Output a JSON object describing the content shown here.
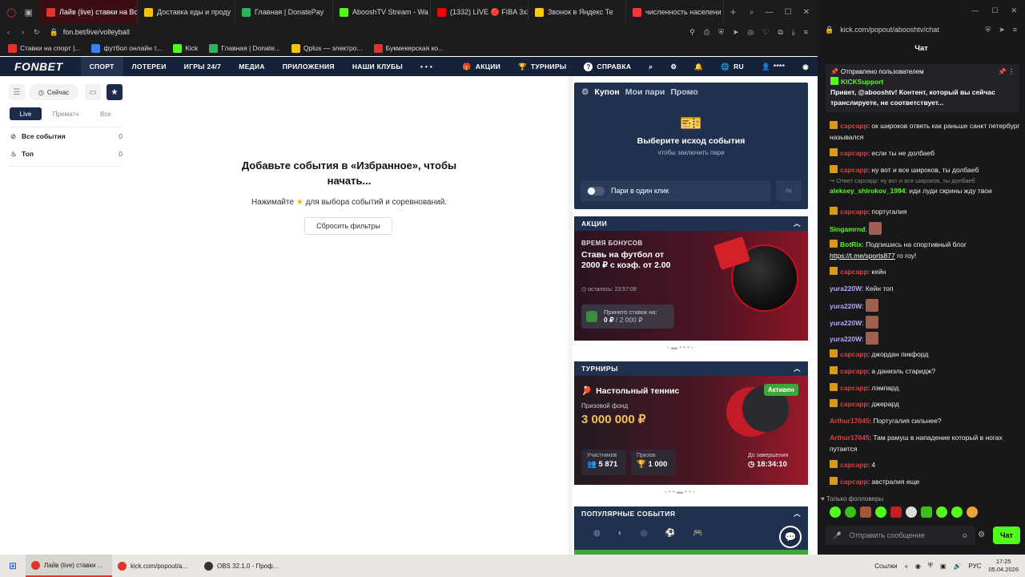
{
  "browser": {
    "tabs": [
      {
        "title": "Лайв (live) ставки на Вол",
        "color": "#e2342c",
        "active": true
      },
      {
        "title": "Доставка еды и проду",
        "color": "#f5c400"
      },
      {
        "title": "Главная | DonatePay",
        "color": "#2fb45a"
      },
      {
        "title": "AbooshTV Stream - Wa",
        "color": "#53fc18"
      },
      {
        "title": "(1332) LIVE 🔴 FIBA 3x3",
        "color": "#ff0000"
      },
      {
        "title": "Звонок в Яндекс Те",
        "color": "#ffcc00"
      },
      {
        "title": "численность населени",
        "color": "#ff3333"
      }
    ],
    "new_tab": "+",
    "url": "fon.bet/live/volleyball",
    "bookmarks": [
      {
        "label": "Ставки на спорт |...",
        "color": "#e2342c"
      },
      {
        "label": "футбол онлайн т...",
        "color": "#3b82f6"
      },
      {
        "label": "Kick",
        "color": "#53fc18"
      },
      {
        "label": "Главная | Donate...",
        "color": "#2fb45a"
      },
      {
        "label": "Qplus — электро...",
        "color": "#f5c400"
      },
      {
        "label": "Букмекерская ко...",
        "color": "#e2342c"
      }
    ]
  },
  "fonbet": {
    "logo": "FONBET",
    "nav": [
      "СПОРТ",
      "ЛОТЕРЕИ",
      "ИГРЫ 24/7",
      "МЕДИА",
      "ПРИЛОЖЕНИЯ",
      "НАШИ КЛУБЫ",
      "• • •"
    ],
    "nav_right": [
      "АКЦИИ",
      "ТУРНИРЫ",
      "СПРАВКА"
    ],
    "lang": "RU",
    "balance_mask": "****",
    "filter_now": "Сейчас",
    "mode_tabs": [
      "Live",
      "Прематч",
      "Все"
    ],
    "sidebar": [
      {
        "label": "Все события",
        "count": "0"
      },
      {
        "label": "Топ",
        "count": "0"
      }
    ],
    "empty": {
      "title": "Добавьте события в «Избранное», чтобы начать...",
      "hint_before": "Нажимайте",
      "hint_after": "для выбора событий и соревнований.",
      "reset_button": "Сбросить фильтры"
    },
    "coupon": {
      "tabs": [
        "Купон",
        "Мои пари",
        "Промо"
      ],
      "title": "Выберите исход события",
      "subtitle": "чтобы заключить пари",
      "one_click": "Пари в один клик"
    },
    "promo": {
      "header": "АКЦИИ",
      "label": "ВРЕМЯ БОНУСОВ",
      "title": "Ставь на футбол от 2000 ₽ с коэф. от 2.00",
      "timer": "осталось: 23:57:09",
      "accepted_label": "Принято ставок на:",
      "accepted_value": "0 ₽",
      "accepted_total": "/ 2 000 ₽"
    },
    "tournaments": {
      "header": "ТУРНИРЫ",
      "name": "Настольный теннис",
      "status": "Активен",
      "fund_label": "Призовой фонд",
      "fund": "3 000 000 ₽",
      "participants_label": "Участников",
      "participants": "5 871",
      "prizes_label": "Призов",
      "prizes": "1 000",
      "end_label": "До завершения",
      "end": "18:34:10"
    },
    "popular": {
      "header": "ПОПУЛЯРНЫЕ СОБЫТИЯ"
    }
  },
  "chat": {
    "url": "kick.com/popout/abooshtv/chat",
    "title": "Чат",
    "pinned_by": "Отправлено пользователем",
    "pinned_user": "KICKSupport",
    "pinned_text": "Привет, @abooshtv! Контент, который вы сейчас транслируете, не соответствует...",
    "messages": [
      {
        "user": "сарсарр",
        "color": "#e0403a",
        "badge": true,
        "text": ": ок широков ответь как раньше санкт петербург назывался"
      },
      {
        "user": "сарсарр",
        "color": "#e0403a",
        "badge": true,
        "text": ": если ты не долбаеб"
      },
      {
        "user": "сарсарр",
        "color": "#e0403a",
        "badge": true,
        "text": ": ну вот и все широков, ты долбаеб"
      },
      {
        "reply": "Ответ сарсарр: ну вот и все широков, ты долбаеб",
        "user": "aleksey_shirokov_1994",
        "color": "#53fc18",
        "text": ": иди луди скрины жду твои"
      },
      {
        "user": "сарсарр",
        "color": "#e0403a",
        "badge": true,
        "text": ": португалия"
      },
      {
        "user": "Singamrnd",
        "color": "#53fc18",
        "text": ":",
        "emote": true
      },
      {
        "user": "BotRix",
        "color": "#53fc18",
        "badge": true,
        "text": ": Подпишись на спортивный блог",
        "link": "https://t.me/sports877",
        "after": " го гоу!"
      },
      {
        "user": "сарсарр",
        "color": "#e0403a",
        "badge": true,
        "text": ": кейн"
      },
      {
        "user": "yura220W",
        "color": "#b7a6ff",
        "text": ": Кейн топ"
      },
      {
        "user": "yura220W",
        "color": "#b7a6ff",
        "text": ":",
        "emote": true
      },
      {
        "user": "yura220W",
        "color": "#b7a6ff",
        "text": ":",
        "emote": true
      },
      {
        "user": "yura220W",
        "color": "#b7a6ff",
        "text": ":",
        "emote": true
      },
      {
        "user": "сарсарр",
        "color": "#e0403a",
        "badge": true,
        "text": ": джордан пикфорд"
      },
      {
        "user": "сарсарр",
        "color": "#e0403a",
        "badge": true,
        "text": ": а даниэль старидж?"
      },
      {
        "user": "сарсарр",
        "color": "#e0403a",
        "badge": true,
        "text": ": лэмпард"
      },
      {
        "user": "сарсарр",
        "color": "#e0403a",
        "badge": true,
        "text": ": джерард"
      },
      {
        "user": "Arthur17045",
        "color": "#e0403a",
        "text": ": Португалия сильнее?"
      },
      {
        "user": "Arthur17045",
        "color": "#e0403a",
        "text": ": Там рамуш в нападение который в ногах путается"
      },
      {
        "user": "сарсарр",
        "color": "#e0403a",
        "badge": true,
        "text": ": 4"
      },
      {
        "user": "сарсарр",
        "color": "#e0403a",
        "badge": true,
        "text": ": австралия еще"
      }
    ],
    "followers_only": "Только фолловеры",
    "input_placeholder": "Отправить сообщение",
    "send_button": "Чат"
  },
  "taskbar": {
    "items": [
      "Лайв (live) ставки ...",
      "kick.com/popout/a...",
      "OBS 32.1.0 - Проф..."
    ],
    "links": "Ссылки",
    "lang": "РУС",
    "time": "17:25",
    "date": "05.04.2026"
  }
}
